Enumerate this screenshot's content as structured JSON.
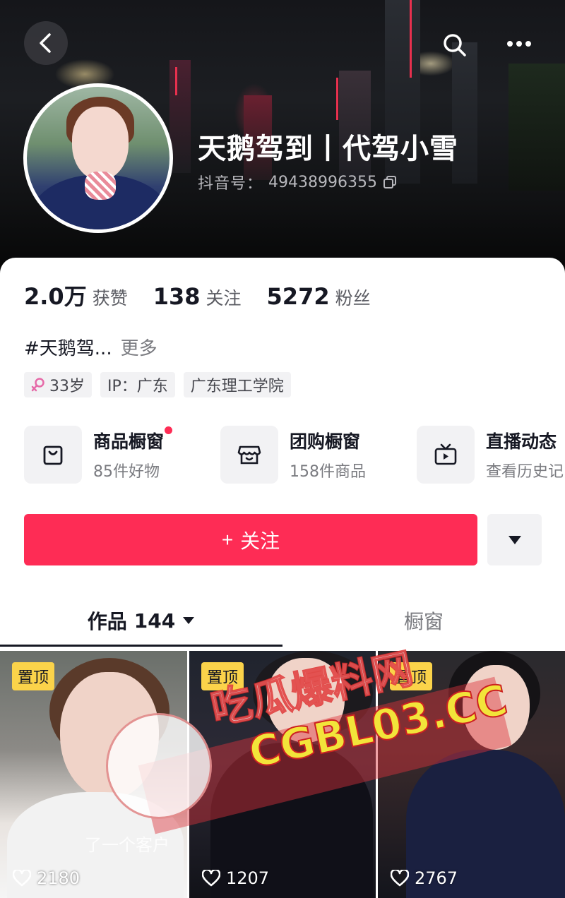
{
  "header": {
    "name": "天鹅驾到丨代驾小雪",
    "uid_label": "抖音号：",
    "uid_value": "49438996355"
  },
  "stats": [
    {
      "value": "2.0万",
      "label": "获赞"
    },
    {
      "value": "138",
      "label": "关注"
    },
    {
      "value": "5272",
      "label": "粉丝"
    }
  ],
  "bio": {
    "text": "#天鹅驾...",
    "more": "更多"
  },
  "tags": {
    "age": "33岁",
    "ip": "IP：广东",
    "school": "广东理工学院"
  },
  "features": [
    {
      "title": "商品橱窗",
      "subtitle": "85件好物",
      "icon": "shopping-bag-icon",
      "dot": true
    },
    {
      "title": "团购橱窗",
      "subtitle": "158件商品",
      "icon": "store-icon",
      "dot": false
    },
    {
      "title": "直播动态",
      "subtitle": "查看历史记",
      "icon": "tv-icon",
      "dot": false
    }
  ],
  "follow_button": {
    "plus": "+",
    "label": "关注"
  },
  "tabs": {
    "works_label": "作品",
    "works_count": "144",
    "window_label": "橱窗"
  },
  "videos": [
    {
      "pinned": "置顶",
      "likes": "2180",
      "caption": "了一个客户"
    },
    {
      "pinned": "置顶",
      "likes": "1207"
    },
    {
      "pinned": "置顶",
      "likes": "2767"
    }
  ],
  "watermark": {
    "line1": "吃瓜爆料网",
    "line2": "CGBL03.CC"
  },
  "colors": {
    "accent": "#fe2c55",
    "badge": "#fbd34a",
    "text_primary": "#161823",
    "text_secondary": "#7a7b80"
  }
}
